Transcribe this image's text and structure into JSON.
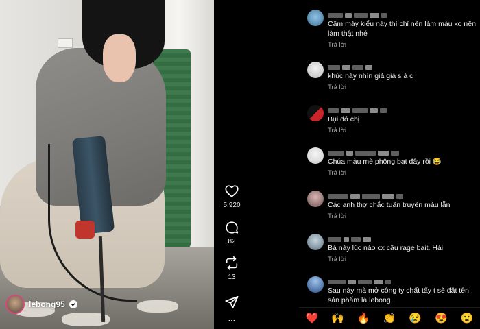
{
  "post": {
    "username": "lebong95",
    "verified": true
  },
  "actions": {
    "like_count": "5.920",
    "comment_count": "82",
    "repost_count": "13"
  },
  "comments": [
    {
      "text": "Cầm máy kiểu này thì chỉ nên làm màu ko nên làm thật nhé",
      "reply": "Trả lời"
    },
    {
      "text": "khúc này nhìn giả giả s á c",
      "reply": "Trả lời"
    },
    {
      "text": "Bụi đó chị",
      "reply": "Trả lời"
    },
    {
      "text": "Chúa màu mè phông bạt đây rồi 😂",
      "reply": "Trả lời"
    },
    {
      "text": "Các anh thợ chắc tuấn truyền máu lẫn",
      "reply": "Trả lời"
    },
    {
      "text": "Bà này lúc nào cx câu rage bait. Hài",
      "reply": "Trả lời"
    },
    {
      "text": "Sau này mà mở công ty chất tẩy t sẽ đặt tên sản phẩm là lebong",
      "reply": "Trả lời"
    }
  ],
  "emoji_bar": [
    "❤️",
    "🙌",
    "🔥",
    "👏",
    "😢",
    "😍",
    "😮"
  ],
  "icons": {
    "like": "heart-icon",
    "comment": "comment-bubble-icon",
    "repost": "repost-icon",
    "share": "send-icon",
    "more": "more-icon",
    "verified": "verified-badge-icon"
  },
  "colors": {
    "background": "#000000",
    "text": "#f0f0f0",
    "secondary_text": "#a8a8a8",
    "avatar_ring": "#d14b7a"
  }
}
